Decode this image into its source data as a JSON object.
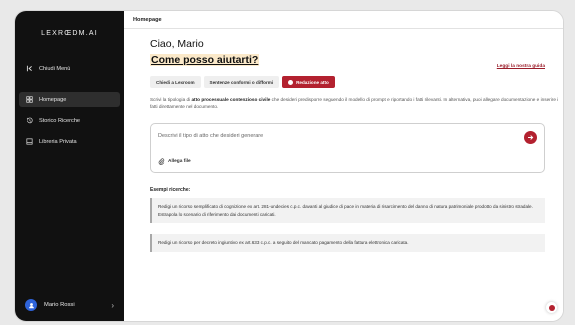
{
  "brand": {
    "logo": "LEXRŒDM.AI"
  },
  "sidebar": {
    "collapse_label": "Chiudi Menù",
    "items": [
      {
        "label": "Homepage",
        "icon": "grid-icon",
        "active": true
      },
      {
        "label": "Storico Ricerche",
        "icon": "history-icon",
        "active": false
      },
      {
        "label": "Libreria Privata",
        "icon": "library-icon",
        "active": false
      }
    ],
    "user_name": "Mario Rossi"
  },
  "topbar": {
    "title": "Homepage"
  },
  "main": {
    "greeting": "Ciao, Mario",
    "subtitle": "Come posso aiutarti?",
    "guide_link": "Leggi la nostra guida",
    "tabs": [
      {
        "label": "Chiedi a Lexroom",
        "active": false
      },
      {
        "label": "Sentenze conformi o difformi",
        "active": false
      },
      {
        "label": "Redazione atto",
        "active": true
      }
    ],
    "desc_start": "Scrivi la tipologia di ",
    "desc_bold": "atto processuale contenzioso civile",
    "desc_end": " che desideri predisporre seguendo il modello di prompt e riportando i fatti rilevanti. In alternativa, puoi allegare documentazione e inserire i fatti direttamente nel documento.",
    "input_placeholder": "Descrivi il tipo di atto che desideri generare",
    "attach_label": "Allega file",
    "examples_title": "Esempi ricerche:",
    "examples": [
      "Redigi un ricorso semplificato di cognizione ex art. 281-undecies c.p.c. davanti al giudice di pace in materia di risarcimento del danno di natura patrimoniale prodotto da sinistro stradale. Estrapola lo scenario di riferimento dai documenti caricati.",
      "Redigi un ricorso per decreto ingiuntivo ex art.633 c.p.c. a seguito del mancato pagamento della fattura elettronica caricata."
    ]
  },
  "colors": {
    "accent": "#b3212f",
    "sidebar_bg": "#111111",
    "highlight": "#fbe9c9"
  }
}
